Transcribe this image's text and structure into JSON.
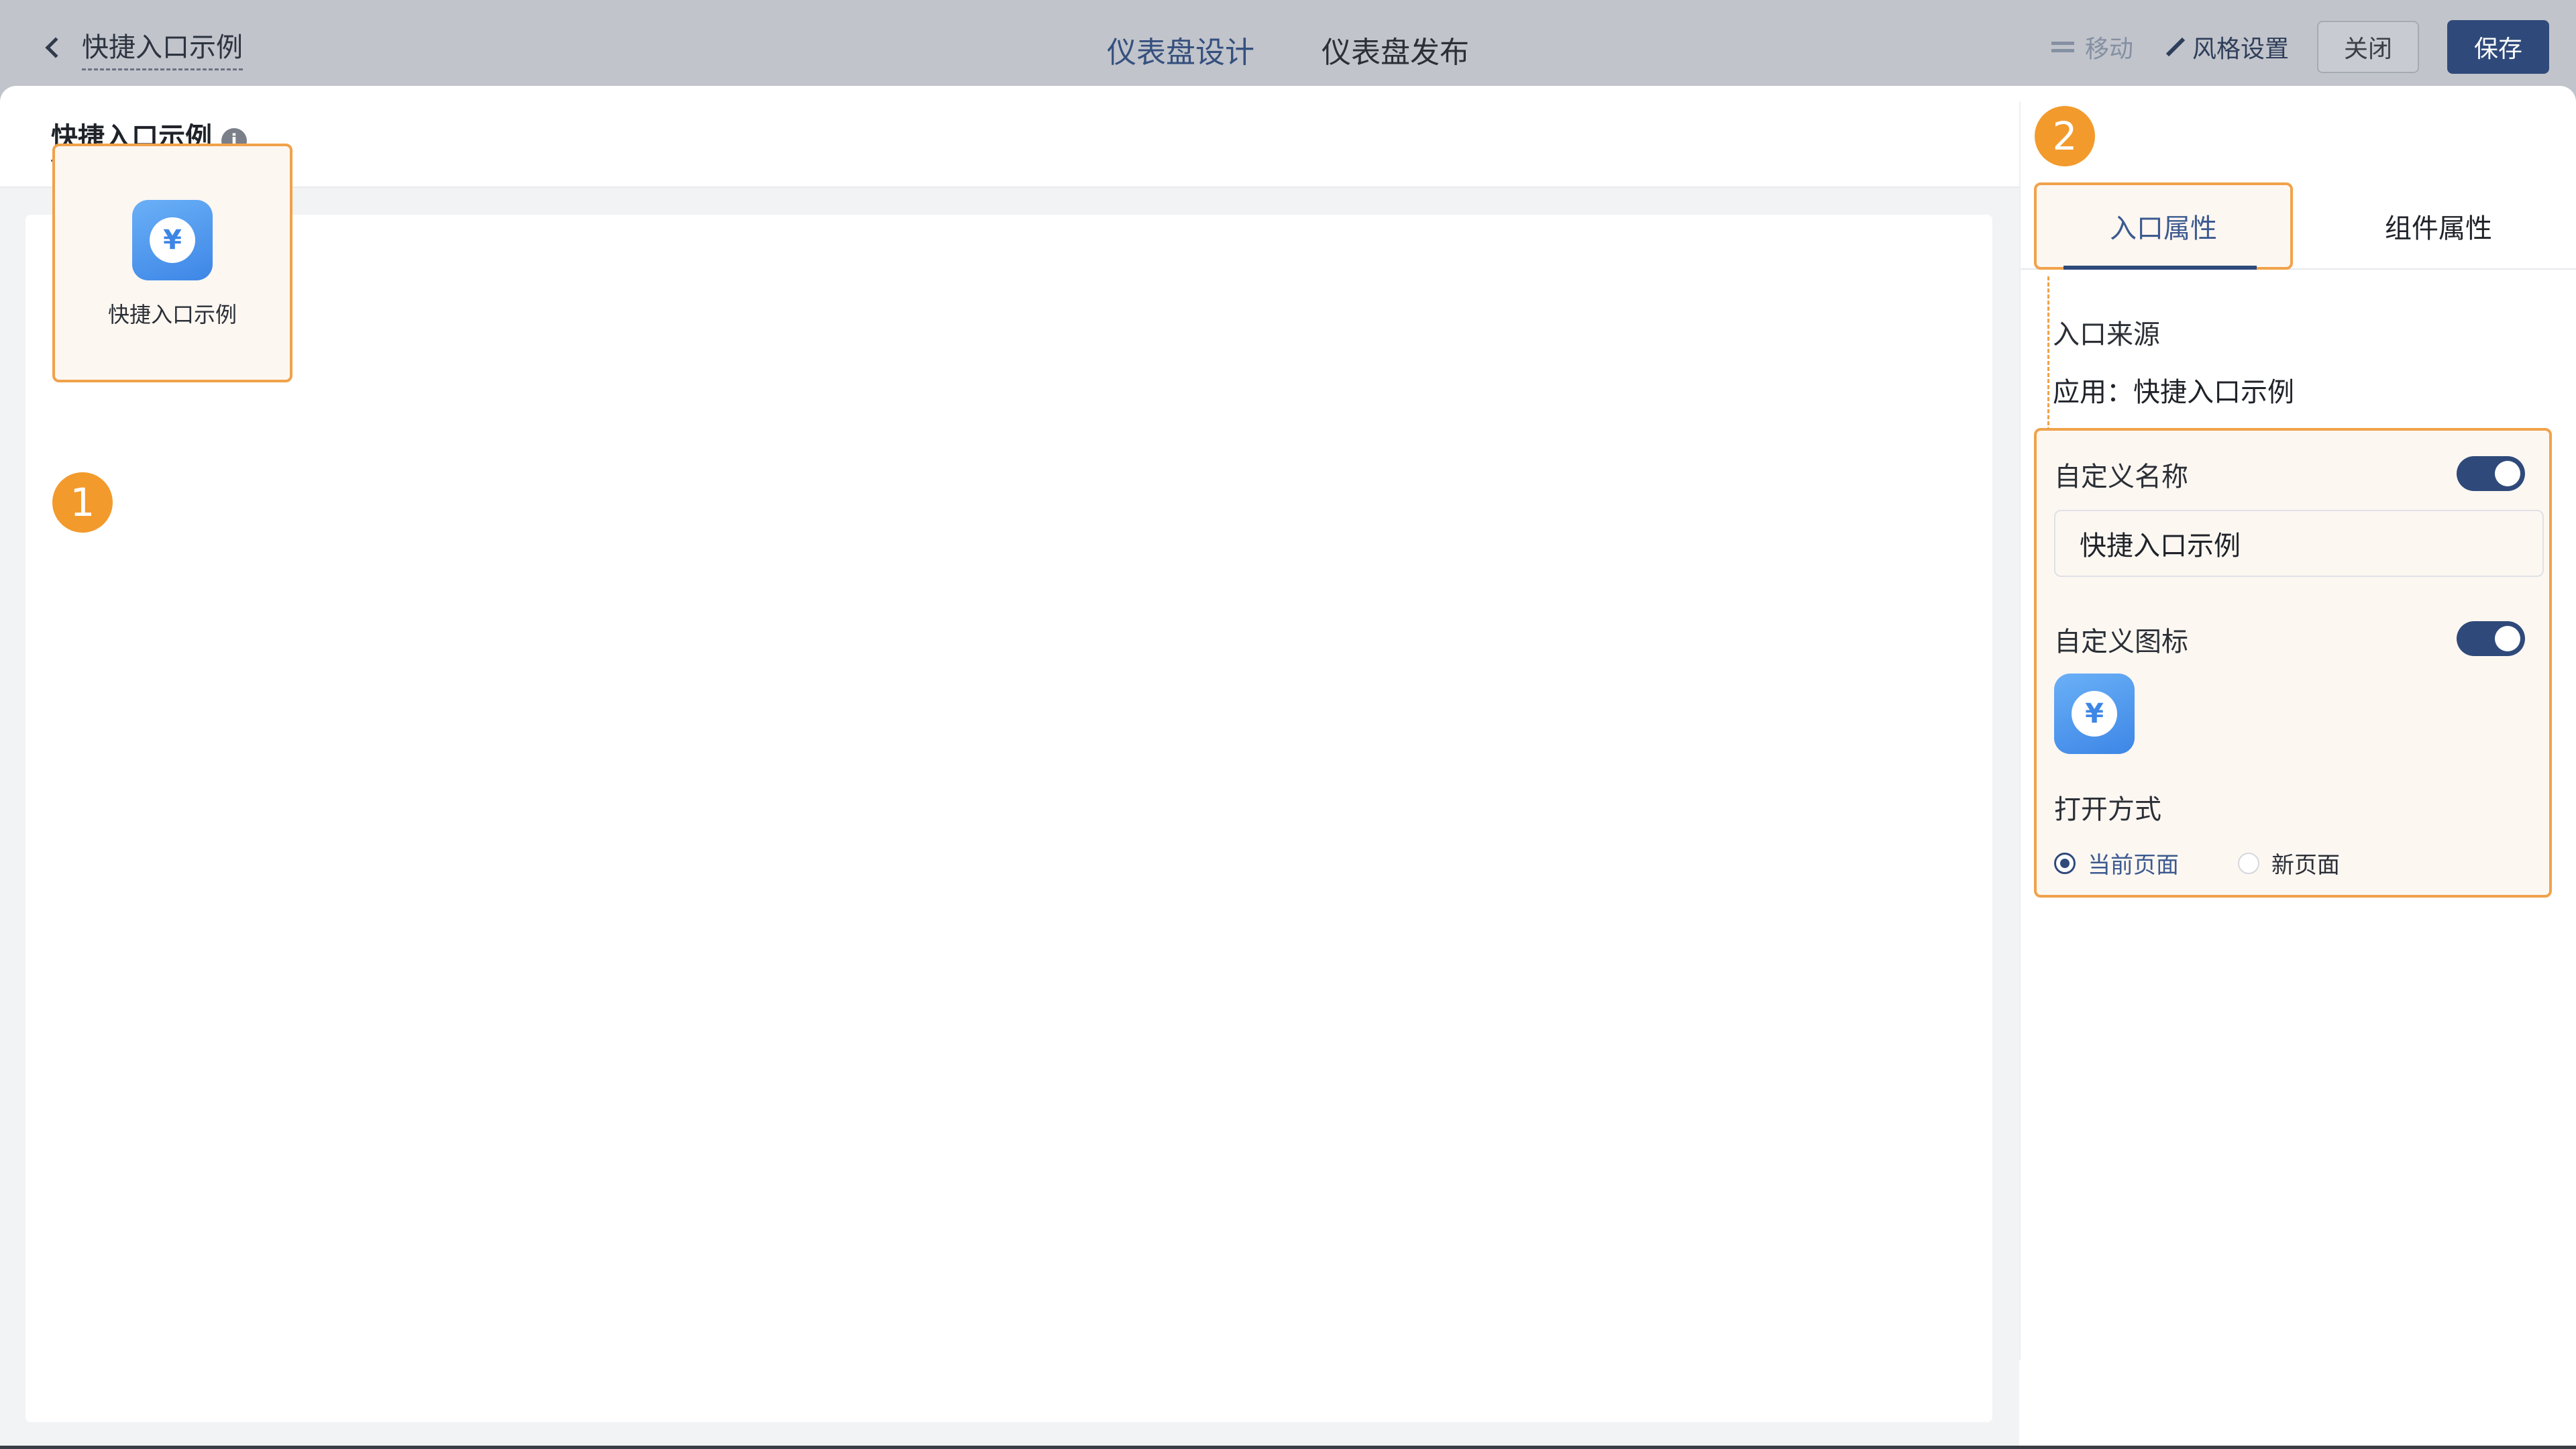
{
  "topbar": {
    "back_title": "快捷入口示例",
    "tabs": [
      "仪表盘设计",
      "仪表盘发布"
    ],
    "move_label": "移动",
    "style_label": "风格设置",
    "close_label": "关闭",
    "save_label": "保存"
  },
  "modal": {
    "title": "快捷入口示例",
    "info_icon": "i",
    "save_label": "保存"
  },
  "canvas": {
    "entry_label": "快捷入口示例",
    "badge_1": "1",
    "badge_2": "2"
  },
  "panel": {
    "tabs": [
      "入口属性",
      "组件属性"
    ],
    "source_title": "入口来源",
    "source_value": "应用：快捷入口示例",
    "custom_name_label": "自定义名称",
    "custom_name_value": "快捷入口示例",
    "custom_icon_label": "自定义图标",
    "open_mode_label": "打开方式",
    "open_options": [
      "当前页面",
      "新页面"
    ],
    "icon_symbol": "¥"
  },
  "colors": {
    "primary": "#2f4a7a",
    "highlight": "#f0a24a",
    "badge": "#f39a2c",
    "app_icon": "#3d86e6"
  }
}
